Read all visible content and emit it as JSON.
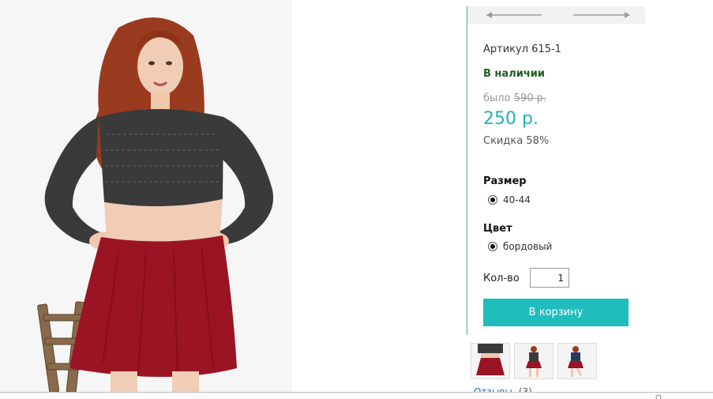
{
  "product": {
    "sku": "Артикул 615-1",
    "stock": "В наличии",
    "old_price_prefix": "было",
    "old_price": "590 р.",
    "price": "250 р.",
    "discount": "Скидка 58%"
  },
  "options": {
    "size": {
      "title": "Размер",
      "value": "40-44",
      "selected": true
    },
    "color": {
      "title": "Цвет",
      "value": "бордовый",
      "selected": true
    }
  },
  "quantity": {
    "label": "Кол-во",
    "value": "1"
  },
  "cart_button": {
    "label": "В корзину"
  },
  "thumbnails": [
    "thumbnail-1",
    "thumbnail-2",
    "thumbnail-3"
  ],
  "reviews": {
    "label": "Отзывы",
    "count": "(3)"
  },
  "colors": {
    "accent": "#1fbdbd",
    "price": "#20b5b5",
    "stock": "#1f5f1f",
    "skirt": "#9b1423",
    "top": "#3a3a3a",
    "hair": "#9a3a1f"
  },
  "icons": [
    "arrow-left-icon",
    "arrow-right-icon",
    "radio-selected-icon",
    "search-icon"
  ]
}
